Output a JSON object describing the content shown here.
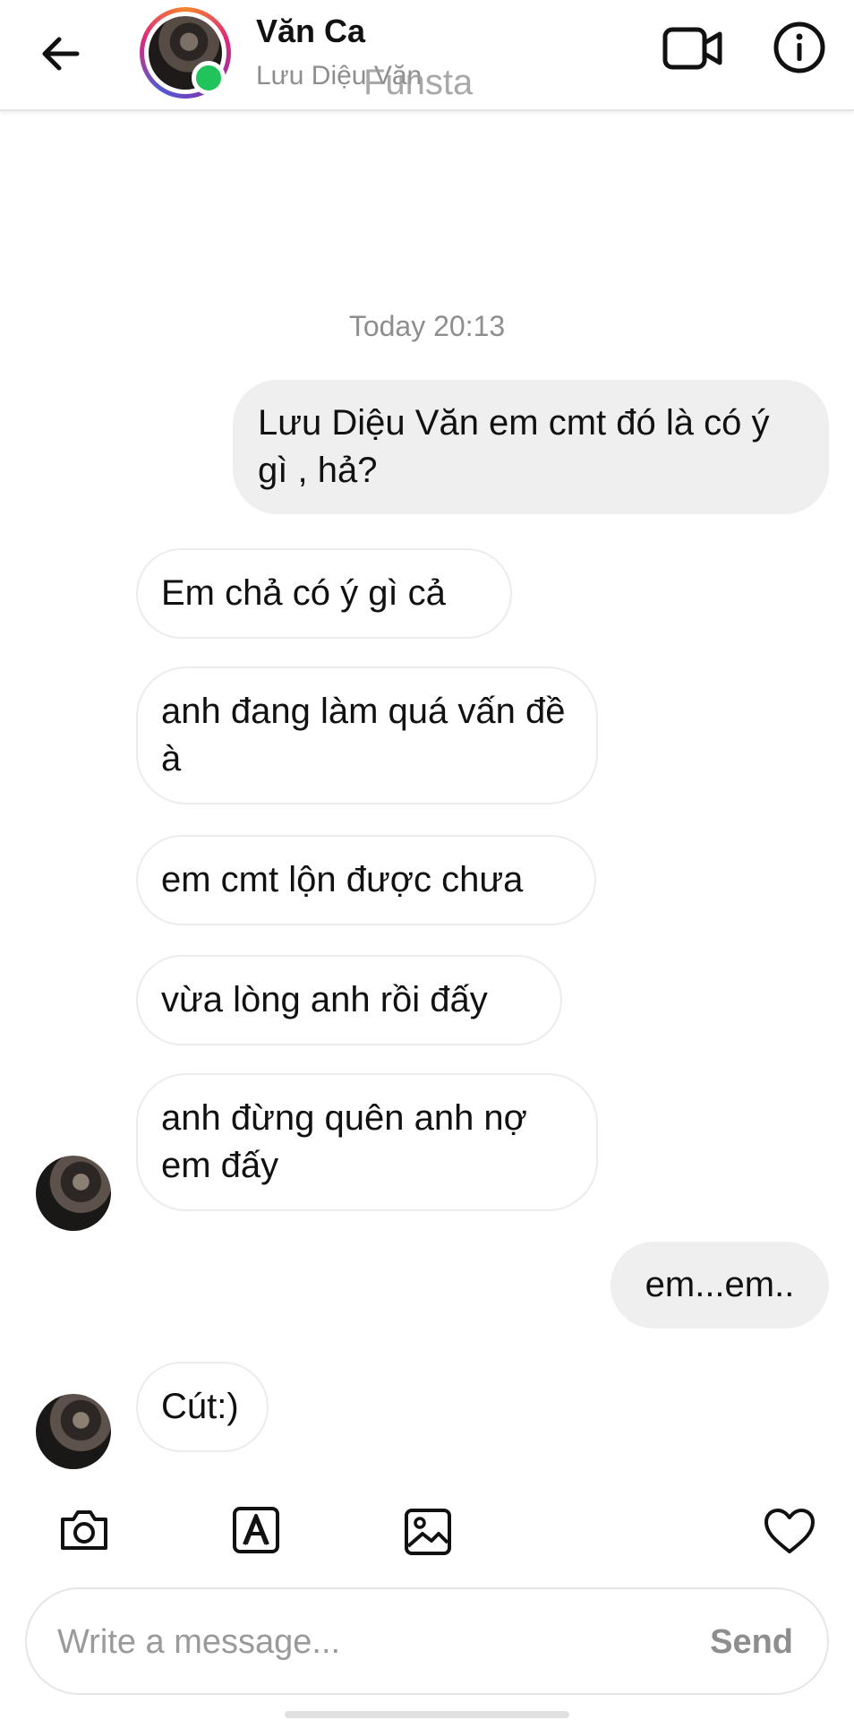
{
  "header": {
    "title": "Văn Ca",
    "subtitle": "Lưu Diệu Văn",
    "watermark": "Funsta",
    "online": true
  },
  "conversation": {
    "timestamp": "Today 20:13",
    "messages": [
      {
        "side": "out",
        "text": "Lưu Diệu Văn em cmt đó là có ý gì , hả?"
      },
      {
        "side": "in",
        "text": "Em chả có ý gì cả"
      },
      {
        "side": "in",
        "text": "anh đang làm quá vấn đề à"
      },
      {
        "side": "in",
        "text": "em cmt lộn được chưa"
      },
      {
        "side": "in",
        "text": "vừa lòng anh rồi đấy"
      },
      {
        "side": "in",
        "text": "anh đừng quên anh nợ em đấy"
      },
      {
        "side": "out",
        "text": "em...em.."
      },
      {
        "side": "in",
        "text": "Cút:)"
      }
    ]
  },
  "toolbar": {
    "icons": [
      "camera-icon",
      "sticker-icon",
      "gallery-icon",
      "heart-icon"
    ]
  },
  "composer": {
    "placeholder": "Write a message...",
    "send_label": "Send"
  },
  "colors": {
    "online": "#20c45a",
    "outgoing_bubble": "#efefef",
    "incoming_border": "#ececec",
    "muted_text": "#8e8e8e"
  }
}
